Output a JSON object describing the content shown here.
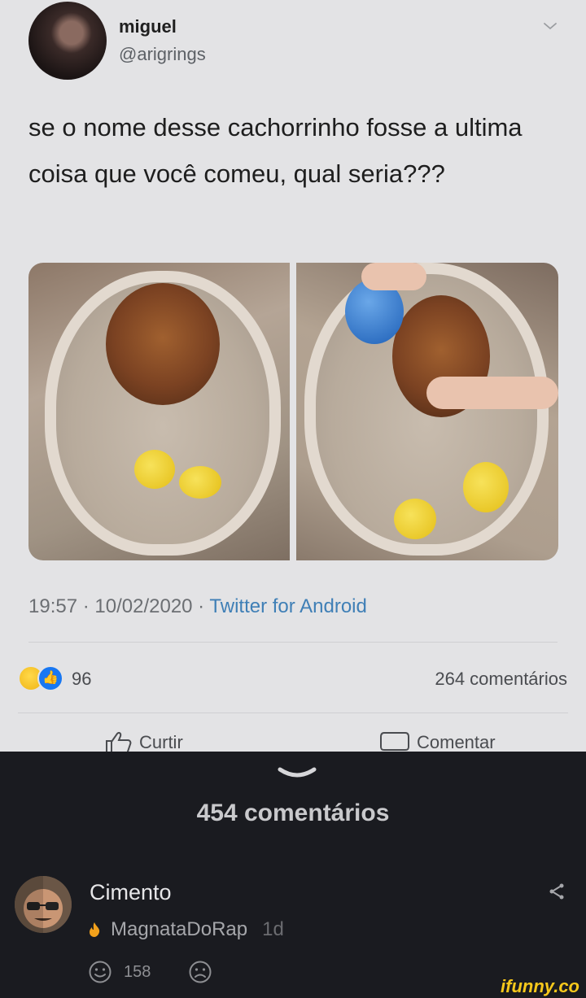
{
  "post": {
    "author_name": "miguel",
    "author_handle": "@arigrings",
    "text": "se o nome desse cachorrinho fosse a ultima coisa que você comeu, qual seria???",
    "time": "19:57",
    "date": "10/02/2020",
    "source": "Twitter for Android",
    "separator": " · "
  },
  "reactions": {
    "icons": [
      "haha-icon",
      "like-icon"
    ],
    "count": "96",
    "comments": "264 comentários"
  },
  "actions": {
    "like_label": "Curtir",
    "comment_label": "Comentar"
  },
  "comments_section": {
    "title": "454 comentários"
  },
  "comment": {
    "author": "Cimento",
    "reply_to": "MagnataDoRap",
    "time": "1d",
    "upvotes": "158"
  },
  "watermark": "ifunny.co",
  "colors": {
    "shot_bg": "#e3e3e5",
    "dark_bg": "#1a1b20",
    "link": "#3f7fb6",
    "flame": "#f2a11c",
    "watermark": "#f7c81b"
  }
}
